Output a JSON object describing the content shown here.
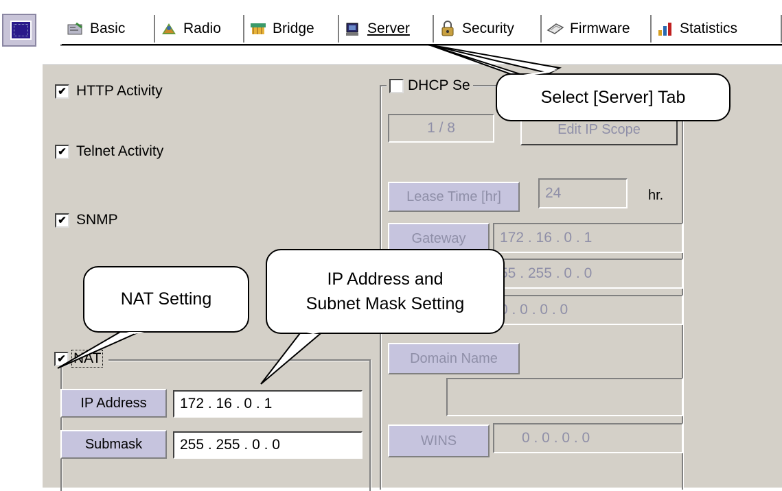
{
  "tabs": [
    {
      "label": "Basic",
      "icon": "basic-icon"
    },
    {
      "label": "Radio",
      "icon": "radio-icon"
    },
    {
      "label": "Bridge",
      "icon": "bridge-icon"
    },
    {
      "label": "Server",
      "icon": "server-icon",
      "active": true
    },
    {
      "label": "Security",
      "icon": "security-icon"
    },
    {
      "label": "Firmware",
      "icon": "firmware-icon"
    },
    {
      "label": "Statistics",
      "icon": "statistics-icon"
    }
  ],
  "options": {
    "http": {
      "label": "HTTP Activity",
      "checked": true
    },
    "telnet": {
      "label": "Telnet Activity",
      "checked": true
    },
    "snmp": {
      "label": "SNMP",
      "checked": true
    }
  },
  "nat": {
    "label": "NAT",
    "checked": true,
    "ip_label": "IP Address",
    "ip_value": "172 . 16  .  0  .  1",
    "mask_label": "Submask",
    "mask_value": "255 . 255 .  0  .  0"
  },
  "dhcp": {
    "label": "DHCP Se",
    "checked": false,
    "scope_value": "1 / 8",
    "edit_scope_label": "Edit IP Scope",
    "lease_label": "Lease Time [hr]",
    "lease_value": "24",
    "lease_unit": "hr.",
    "gateway_label": "Gateway",
    "gateway_value": "172 . 16  .  0  .  1",
    "mask_value": "55 . 255 .  0  .  0",
    "dns_value": "0  .  0  .  0  .  0",
    "domain_label": "Domain Name",
    "domain_value": "",
    "wins_label": "WINS",
    "wins_value": "0  .  0  .  0  .  0"
  },
  "callouts": {
    "server_tab": "Select [Server] Tab",
    "nat": "NAT Setting",
    "ip_line1": "IP Address and",
    "ip_line2": "Subnet Mask Setting"
  },
  "colors": {
    "panel": "#d4d0c8",
    "label_box": "#c6c4de",
    "disabled_text": "#8f8fa8"
  },
  "check_mark": "✔"
}
